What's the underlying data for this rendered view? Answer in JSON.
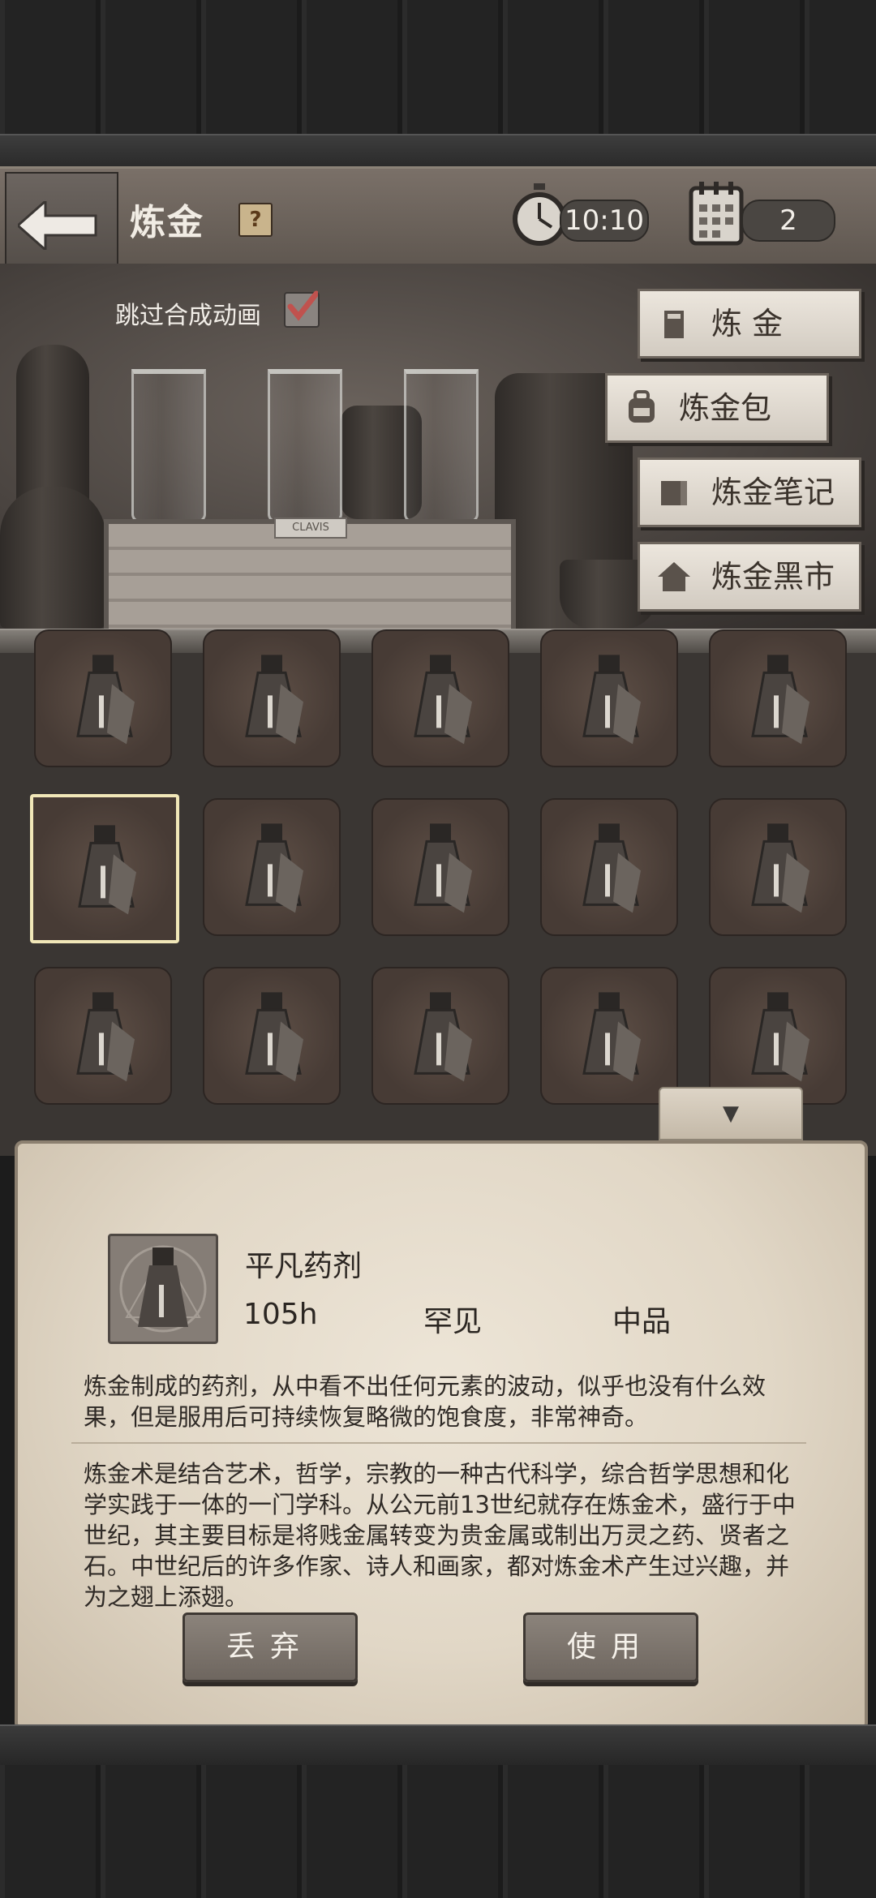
{
  "header": {
    "title": "炼金",
    "help_label": "?",
    "time": "10:10",
    "day": "2"
  },
  "lab": {
    "skip_animation_label": "跳过合成动画",
    "skip_animation_checked": true,
    "crate_plate": "CLAVIS"
  },
  "menu": [
    {
      "label": "炼 金",
      "icon": "alchemy-icon"
    },
    {
      "label": "炼金包",
      "icon": "backpack-icon"
    },
    {
      "label": "炼金笔记",
      "icon": "book-icon"
    },
    {
      "label": "炼金黑市",
      "icon": "house-icon"
    }
  ],
  "grid": {
    "rows": 3,
    "cols": 5,
    "selected_index": 5,
    "item_icon": "potion-flask-icon"
  },
  "dropdown_glyph": "▼",
  "detail": {
    "name": "平凡药剂",
    "duration": "105h",
    "rarity": "罕见",
    "quality": "中品",
    "description": "炼金制成的药剂，从中看不出任何元素的波动，似乎也没有什么效果，但是服用后可持续恢复略微的饱食度，非常神奇。",
    "lore": "炼金术是结合艺术，哲学，宗教的一种古代科学，综合哲学思想和化学实践于一体的一门学科。从公元前13世纪就存在炼金术，盛行于中世纪，其主要目标是将贱金属转变为贵金属或制出万灵之药、贤者之石。中世纪后的许多作家、诗人和画家，都对炼金术产生过兴趣，并为之翅上添翅。",
    "discard_label": "丢弃",
    "use_label": "使用"
  }
}
